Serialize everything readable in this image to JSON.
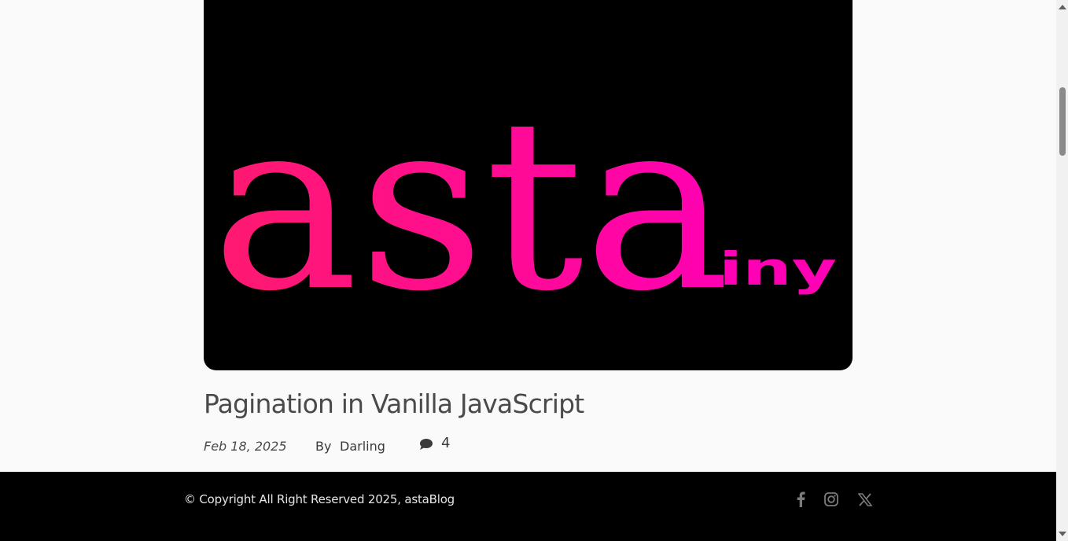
{
  "post": {
    "hero_text": "asta",
    "hero_subtext": "iny",
    "title": "Pagination in Vanilla JavaScript",
    "date": "Feb 18, 2025",
    "by_label": "By",
    "author": "Darling",
    "comment_count": "4"
  },
  "footer": {
    "copyright": "© Copyright All Right Reserved 2025, astaBlog",
    "social": [
      "facebook-icon",
      "instagram-icon",
      "x-icon"
    ]
  },
  "colors": {
    "page_bg": "#fafafa",
    "hero_bg": "#000000",
    "brand_start": "#ff1a6e",
    "brand_end": "#ff00b4",
    "footer_bg": "#000000"
  }
}
